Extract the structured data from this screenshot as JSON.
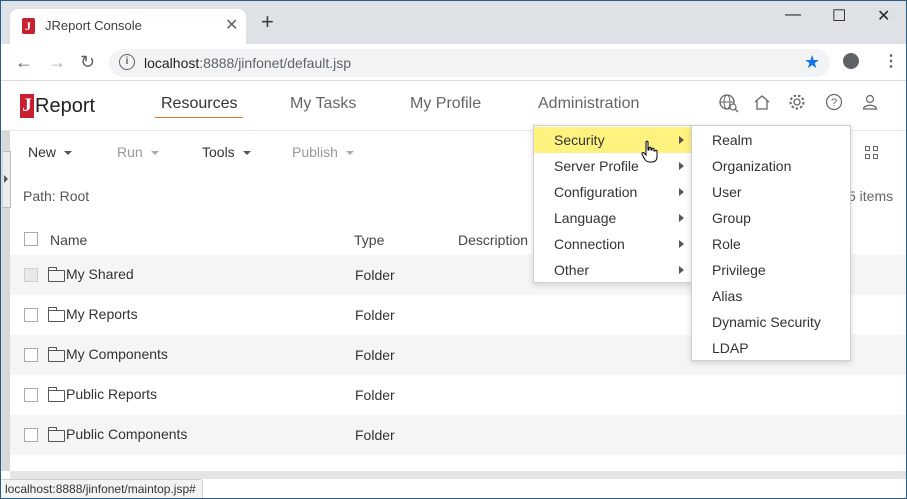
{
  "browser": {
    "tab_title": "JReport Console",
    "new_tab": "+",
    "url_host": "localhost",
    "url_rest": ":8888/jinfonet/default.jsp",
    "status_url": "localhost:8888/jinfonet/maintop.jsp#"
  },
  "app": {
    "logo_letter": "J",
    "logo_text": "Report",
    "nav": [
      "Resources",
      "My Tasks",
      "My Profile",
      "Administration"
    ],
    "active_nav": "Resources"
  },
  "actions": {
    "new": "New",
    "run": "Run",
    "tools": "Tools",
    "publish": "Publish"
  },
  "path_label": "Path: Root",
  "item_count": "5 items",
  "table": {
    "headers": [
      "Name",
      "Type",
      "Description"
    ],
    "rows": [
      {
        "name": "My Shared",
        "type": "Folder"
      },
      {
        "name": "My Reports",
        "type": "Folder"
      },
      {
        "name": "My Components",
        "type": "Folder"
      },
      {
        "name": "Public Reports",
        "type": "Folder"
      },
      {
        "name": "Public Components",
        "type": "Folder"
      }
    ]
  },
  "admin_menu": {
    "items": [
      "Security",
      "Server Profile",
      "Configuration",
      "Language",
      "Connection",
      "Other"
    ],
    "highlighted": "Security"
  },
  "security_submenu": {
    "items": [
      "Realm",
      "Organization",
      "User",
      "Group",
      "Role",
      "Privilege",
      "Alias",
      "Dynamic Security",
      "LDAP"
    ]
  },
  "colors": {
    "accent": "#c8202f",
    "highlight": "#fff27f",
    "nav_underline": "#e07b3c",
    "chrome_blue": "#1a73e8"
  }
}
